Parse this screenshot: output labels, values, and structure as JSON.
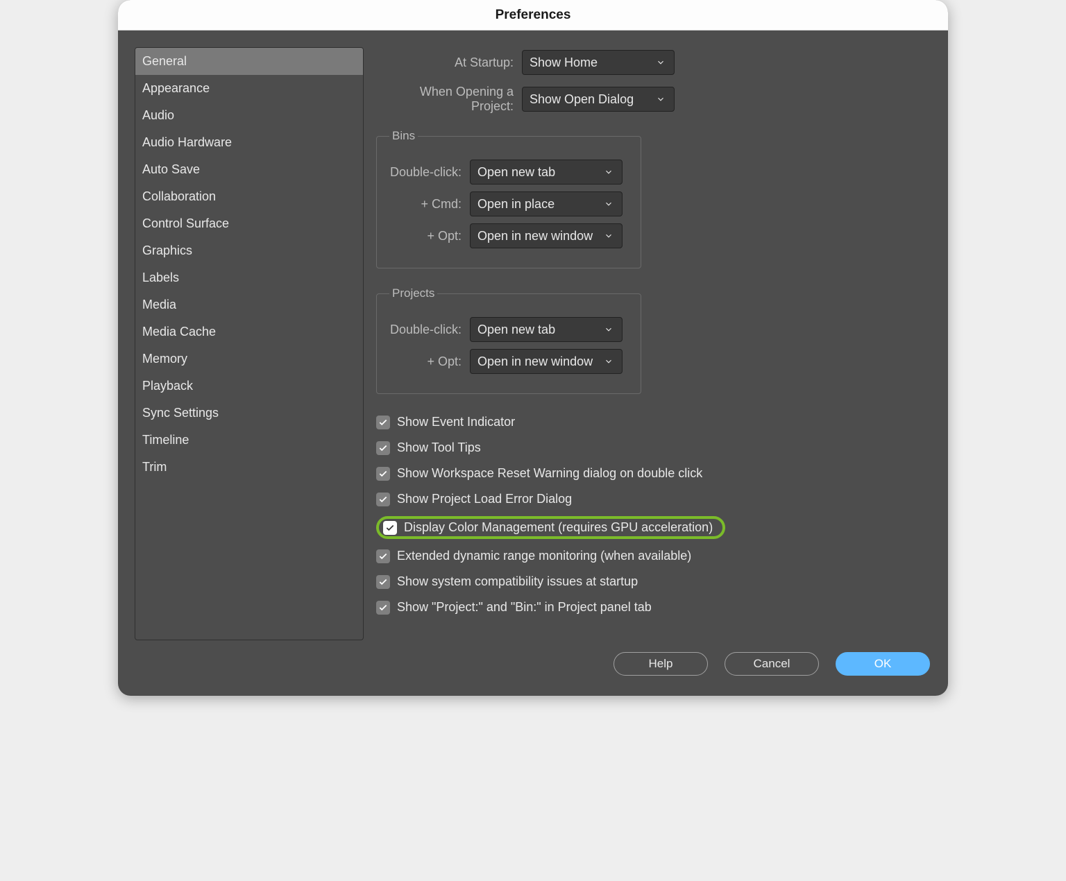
{
  "window": {
    "title": "Preferences"
  },
  "sidebar": {
    "items": [
      "General",
      "Appearance",
      "Audio",
      "Audio Hardware",
      "Auto Save",
      "Collaboration",
      "Control Surface",
      "Graphics",
      "Labels",
      "Media",
      "Media Cache",
      "Memory",
      "Playback",
      "Sync Settings",
      "Timeline",
      "Trim"
    ],
    "selected_index": 0
  },
  "content": {
    "at_startup": {
      "label": "At Startup:",
      "value": "Show Home"
    },
    "when_opening": {
      "label": "When Opening a Project:",
      "value": "Show Open Dialog"
    },
    "bins": {
      "legend": "Bins",
      "double_click": {
        "label": "Double-click:",
        "value": "Open new tab"
      },
      "cmd": {
        "label": "+ Cmd:",
        "value": "Open in place"
      },
      "opt": {
        "label": "+ Opt:",
        "value": "Open in new window"
      }
    },
    "projects": {
      "legend": "Projects",
      "double_click": {
        "label": "Double-click:",
        "value": "Open new tab"
      },
      "opt": {
        "label": "+ Opt:",
        "value": "Open in new window"
      }
    },
    "checkboxes": [
      {
        "label": "Show Event Indicator",
        "checked": true,
        "style": "grey"
      },
      {
        "label": "Show Tool Tips",
        "checked": true,
        "style": "grey"
      },
      {
        "label": "Show Workspace Reset Warning dialog on double click",
        "checked": true,
        "style": "grey"
      },
      {
        "label": "Show Project Load Error Dialog",
        "checked": true,
        "style": "grey"
      },
      {
        "label": "Display Color Management (requires GPU acceleration)",
        "checked": true,
        "style": "white",
        "highlighted": true
      },
      {
        "label": "Extended dynamic range monitoring (when available)",
        "checked": true,
        "style": "grey"
      },
      {
        "label": "Show system compatibility issues at startup",
        "checked": true,
        "style": "grey"
      },
      {
        "label": "Show \"Project:\" and \"Bin:\" in Project panel tab",
        "checked": true,
        "style": "grey"
      }
    ]
  },
  "footer": {
    "help": "Help",
    "cancel": "Cancel",
    "ok": "OK"
  }
}
